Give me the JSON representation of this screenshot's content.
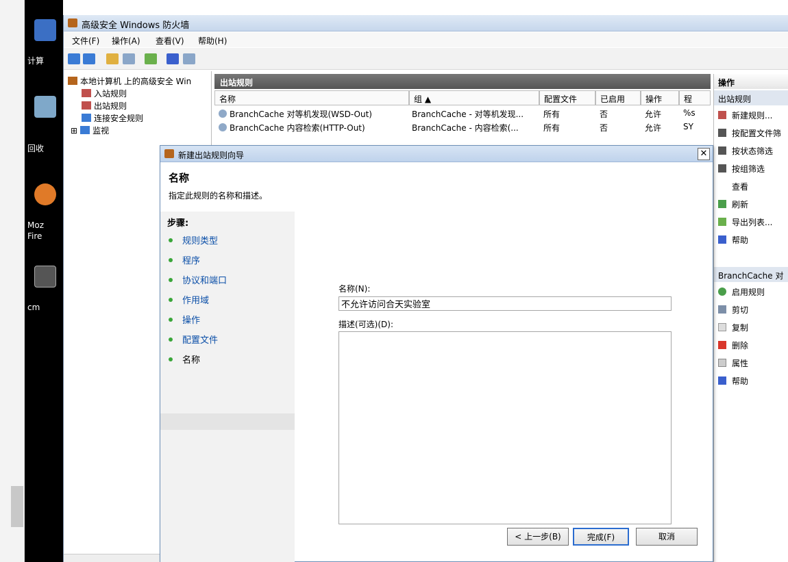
{
  "desktop": {
    "icons": [
      {
        "label": "计算",
        "color": "#3b6fc4"
      },
      {
        "label": "回收",
        "color": "#7fa8c9"
      },
      {
        "label": "Moz",
        "color": "#e07a28"
      },
      {
        "label": "Fire",
        "color": ""
      },
      {
        "label": "cm",
        "color": "#555555"
      }
    ]
  },
  "window": {
    "title": "高级安全 Windows 防火墙",
    "menu": [
      "文件(F)",
      "操作(A)",
      "查看(V)",
      "帮助(H)"
    ]
  },
  "tree": {
    "root": "本地计算机 上的高级安全 Win",
    "items": [
      "入站规则",
      "出站规则",
      "连接安全规则",
      "监视"
    ],
    "expander": "⊞"
  },
  "list": {
    "header": "出站规则",
    "columns": [
      "名称",
      "组 ▲",
      "配置文件",
      "已启用",
      "操作",
      "程"
    ],
    "rows": [
      [
        "BranchCache 对等机发现(WSD-Out)",
        "BranchCache - 对等机发现...",
        "所有",
        "否",
        "允许",
        "%s"
      ],
      [
        "BranchCache 内容检索(HTTP-Out)",
        "BranchCache - 内容检索(...",
        "所有",
        "否",
        "允许",
        "SY"
      ]
    ]
  },
  "actions": {
    "header": "操作",
    "section1": "出站规则",
    "items1": [
      "新建规则...",
      "按配置文件筛",
      "按状态筛选",
      "按组筛选",
      "查看",
      "刷新",
      "导出列表...",
      "帮助"
    ],
    "section2": "BranchCache 对",
    "items2": [
      "启用规则",
      "剪切",
      "复制",
      "删除",
      "属性",
      "帮助"
    ]
  },
  "wizard": {
    "title": "新建出站规则向导",
    "heading": "名称",
    "subtitle": "指定此规则的名称和描述。",
    "steps_title": "步骤:",
    "steps": [
      "规则类型",
      "程序",
      "协议和端口",
      "作用域",
      "操作",
      "配置文件",
      "名称"
    ],
    "name_label": "名称(N):",
    "name_value": "不允许访问合天实验室",
    "desc_label": "描述(可选)(D):",
    "desc_value": "",
    "back_button": "< 上一步(B)",
    "finish_button": "完成(F)",
    "cancel_button": "取消",
    "close_glyph": "✕"
  }
}
